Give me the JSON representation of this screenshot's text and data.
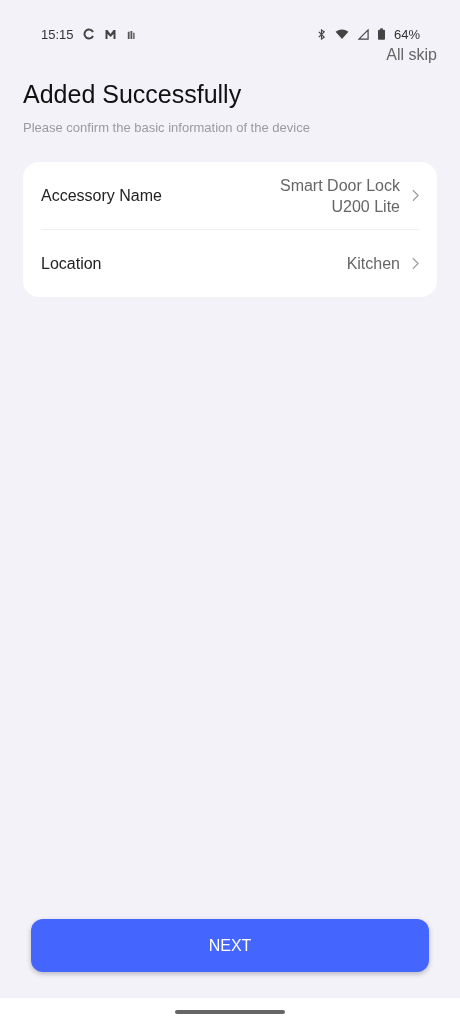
{
  "status_bar": {
    "time": "15:15",
    "battery": "64%"
  },
  "skip": "All skip",
  "title": "Added Successfully",
  "subtitle": "Please confirm the basic information of the device",
  "rows": [
    {
      "label": "Accessory Name",
      "value": [
        "Smart Door Lock",
        "U200 Lite"
      ]
    },
    {
      "label": "Location",
      "value": [
        "Kitchen"
      ]
    }
  ],
  "button": "NEXT"
}
